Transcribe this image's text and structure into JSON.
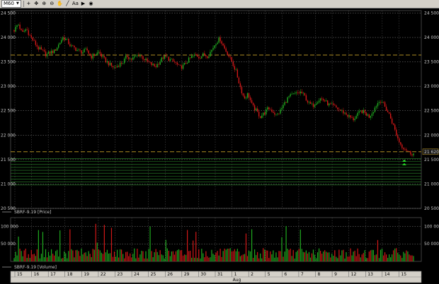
{
  "toolbar": {
    "timeframe": "M60",
    "items": [
      {
        "name": "crosshair-icon",
        "glyph": "+"
      },
      {
        "name": "hand-icon",
        "glyph": "✥"
      },
      {
        "name": "zoom-in-icon",
        "glyph": "⊕"
      },
      {
        "name": "zoom-out-icon",
        "glyph": "⊖"
      },
      {
        "name": "pan-icon",
        "glyph": "✋"
      },
      {
        "name": "line-tool-icon",
        "glyph": "╱"
      },
      {
        "name": "text-tool-icon",
        "glyph": "Aa"
      },
      {
        "name": "marker-icon",
        "glyph": "▶"
      },
      {
        "name": "eye-icon",
        "glyph": "◉"
      }
    ]
  },
  "chart_data": [
    {
      "type": "candlestick",
      "legend": "SBRF-9.19 [Price]",
      "ylim": [
        20500,
        24550
      ],
      "y_ticks": [
        20500,
        21000,
        21500,
        22000,
        22500,
        23000,
        23500,
        24000,
        24500
      ],
      "y_tick_labels": [
        "20 500",
        "21 000",
        "21 500",
        "22 000",
        "22 500",
        "23 000",
        "23 500",
        "24 000",
        "24 500"
      ],
      "horizontal_levels": [
        23640,
        21660
      ],
      "last_price_label": "21 620",
      "support_band": {
        "from": 20980,
        "to": 21520
      },
      "path_points": [
        [
          0,
          24150
        ],
        [
          2,
          24280
        ],
        [
          4,
          24080
        ],
        [
          6,
          24180
        ],
        [
          8,
          24020
        ],
        [
          10,
          23900
        ],
        [
          12,
          23780
        ],
        [
          14,
          23720
        ],
        [
          16,
          23640
        ],
        [
          18,
          23700
        ],
        [
          20,
          23720
        ],
        [
          22,
          23850
        ],
        [
          24,
          24000
        ],
        [
          26,
          23950
        ],
        [
          28,
          23820
        ],
        [
          30,
          23780
        ],
        [
          32,
          23720
        ],
        [
          34,
          23700
        ],
        [
          36,
          23750
        ],
        [
          38,
          23600
        ],
        [
          40,
          23650
        ],
        [
          42,
          23700
        ],
        [
          44,
          23580
        ],
        [
          46,
          23500
        ],
        [
          48,
          23420
        ],
        [
          50,
          23380
        ],
        [
          52,
          23450
        ],
        [
          54,
          23500
        ],
        [
          56,
          23620
        ],
        [
          58,
          23550
        ],
        [
          60,
          23600
        ],
        [
          62,
          23650
        ],
        [
          64,
          23580
        ],
        [
          66,
          23500
        ],
        [
          68,
          23450
        ],
        [
          70,
          23400
        ],
        [
          72,
          23500
        ],
        [
          74,
          23600
        ],
        [
          76,
          23580
        ],
        [
          78,
          23520
        ],
        [
          80,
          23480
        ],
        [
          82,
          23380
        ],
        [
          84,
          23420
        ],
        [
          86,
          23520
        ],
        [
          88,
          23600
        ],
        [
          90,
          23640
        ],
        [
          92,
          23600
        ],
        [
          94,
          23650
        ],
        [
          96,
          23620
        ],
        [
          98,
          23750
        ],
        [
          100,
          23900
        ],
        [
          102,
          23980
        ],
        [
          104,
          23800
        ],
        [
          106,
          23650
        ],
        [
          108,
          23500
        ],
        [
          110,
          23300
        ],
        [
          112,
          23000
        ],
        [
          114,
          22750
        ],
        [
          116,
          22850
        ],
        [
          118,
          22600
        ],
        [
          120,
          22500
        ],
        [
          122,
          22380
        ],
        [
          124,
          22450
        ],
        [
          126,
          22550
        ],
        [
          128,
          22500
        ],
        [
          130,
          22400
        ],
        [
          132,
          22500
        ],
        [
          134,
          22650
        ],
        [
          136,
          22780
        ],
        [
          138,
          22820
        ],
        [
          140,
          22850
        ],
        [
          142,
          22880
        ],
        [
          144,
          22800
        ],
        [
          146,
          22650
        ],
        [
          148,
          22600
        ],
        [
          150,
          22700
        ],
        [
          152,
          22750
        ],
        [
          154,
          22700
        ],
        [
          156,
          22620
        ],
        [
          158,
          22600
        ],
        [
          160,
          22550
        ],
        [
          162,
          22500
        ],
        [
          164,
          22450
        ],
        [
          166,
          22380
        ],
        [
          168,
          22320
        ],
        [
          170,
          22400
        ],
        [
          172,
          22500
        ],
        [
          174,
          22450
        ],
        [
          176,
          22380
        ],
        [
          178,
          22500
        ],
        [
          180,
          22650
        ],
        [
          182,
          22720
        ],
        [
          184,
          22560
        ],
        [
          186,
          22420
        ],
        [
          188,
          22200
        ],
        [
          190,
          21950
        ],
        [
          192,
          21780
        ],
        [
          194,
          21720
        ],
        [
          196,
          21640
        ],
        [
          198,
          21620
        ]
      ],
      "signal_arrows": 2
    },
    {
      "type": "bar",
      "legend": "SBRF-9.19 [Volume]",
      "ylim": [
        0,
        125000
      ],
      "y_ticks": [
        50000,
        100000
      ],
      "y_tick_labels": [
        "50 000",
        "100 000"
      ]
    }
  ],
  "x_axis": {
    "day_labels": [
      "15",
      "16",
      "17",
      "18",
      "19",
      "22",
      "23",
      "24",
      "25",
      "26",
      "29",
      "30",
      "31",
      "1",
      "2",
      "5",
      "6",
      "7",
      "8",
      "9",
      "12",
      "13",
      "14",
      "15"
    ],
    "month_label": "Aug"
  }
}
